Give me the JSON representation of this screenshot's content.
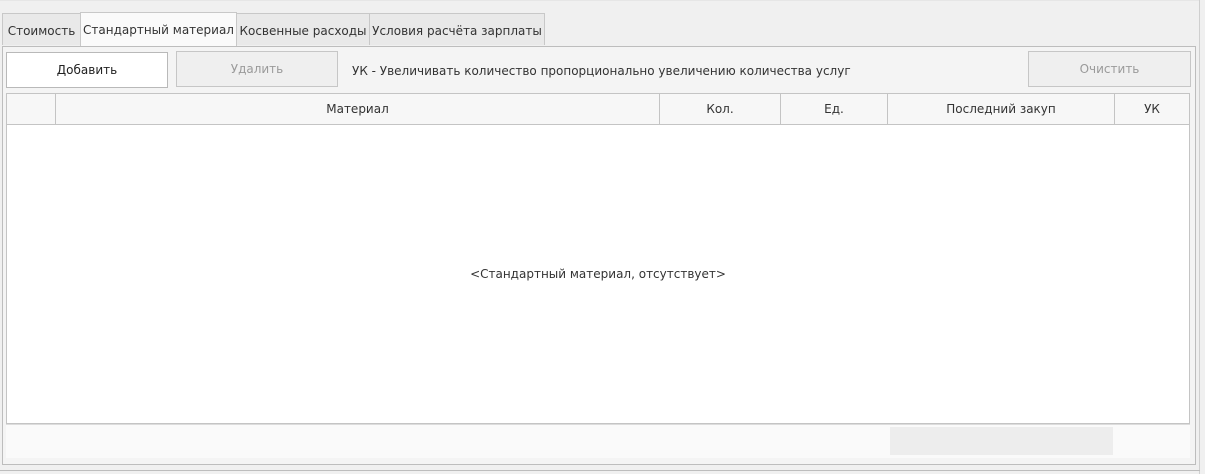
{
  "tabs": [
    {
      "label": "Стоимость",
      "active": false
    },
    {
      "label": "Стандартный материал",
      "active": true
    },
    {
      "label": "Косвенные расходы",
      "active": false
    },
    {
      "label": "Условия расчёта зарплаты",
      "active": false
    }
  ],
  "toolbar": {
    "add_label": "Добавить",
    "delete_label": "Удалить",
    "hint": "УК - Увеличивать количество пропорционально увеличению количества услуг",
    "clear_label": "Очистить"
  },
  "grid": {
    "columns": [
      "",
      "Материал",
      "Кол.",
      "Ед.",
      "Последний закуп",
      "УК"
    ],
    "empty_text": "<Стандартный материал, отсутствует>"
  }
}
